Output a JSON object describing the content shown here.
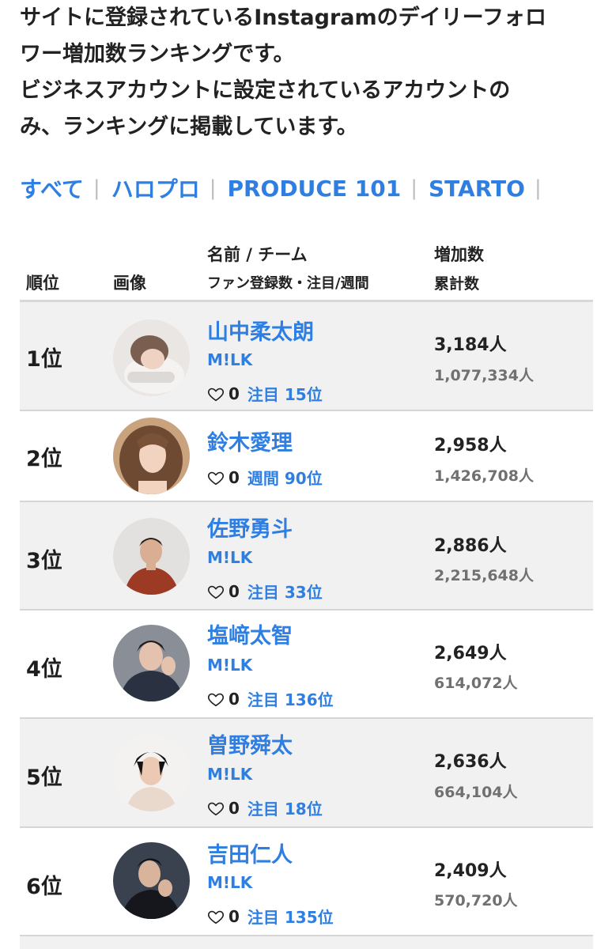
{
  "intro": {
    "lines": [
      "サイトに登録されているInstagramのデイリーフォロ",
      "ワー増加数ランキングです。",
      "ビジネスアカウントに設定されているアカウントの",
      "み、ランキングに掲載しています。"
    ]
  },
  "filters": [
    {
      "label": "すべて"
    },
    {
      "label": "ハロプロ"
    },
    {
      "label": "PRODUCE 101"
    },
    {
      "label": "STARTO"
    }
  ],
  "filter_separator": "|",
  "table": {
    "headers": {
      "rank": "順位",
      "image": "画像",
      "name_team": "名前 / チーム",
      "fans_note": "ファン登録数・注目/週間",
      "increase": "増加数",
      "cumulative": "累計数"
    },
    "rows": [
      {
        "rank": "1位",
        "name": "山中柔太朗",
        "team": "M!LK",
        "fans": "0",
        "note": "注目 15位",
        "increase": "3,184人",
        "total": "1,077,334人"
      },
      {
        "rank": "2位",
        "name": "鈴木愛理",
        "team": "",
        "fans": "0",
        "note": "週間 90位",
        "increase": "2,958人",
        "total": "1,426,708人"
      },
      {
        "rank": "3位",
        "name": "佐野勇斗",
        "team": "M!LK",
        "fans": "0",
        "note": "注目 33位",
        "increase": "2,886人",
        "total": "2,215,648人"
      },
      {
        "rank": "4位",
        "name": "塩﨑太智",
        "team": "M!LK",
        "fans": "0",
        "note": "注目 136位",
        "increase": "2,649人",
        "total": "614,072人"
      },
      {
        "rank": "5位",
        "name": "曽野舜太",
        "team": "M!LK",
        "fans": "0",
        "note": "注目 18位",
        "increase": "2,636人",
        "total": "664,104人"
      },
      {
        "rank": "6位",
        "name": "吉田仁人",
        "team": "M!LK",
        "fans": "0",
        "note": "注目 135位",
        "increase": "2,409人",
        "total": "570,720人"
      }
    ]
  },
  "icons": {
    "heart": "heart-outline-icon"
  },
  "colors": {
    "link": "#2f7fe3",
    "row_alt": "#f1f1f1",
    "muted": "#707070"
  }
}
